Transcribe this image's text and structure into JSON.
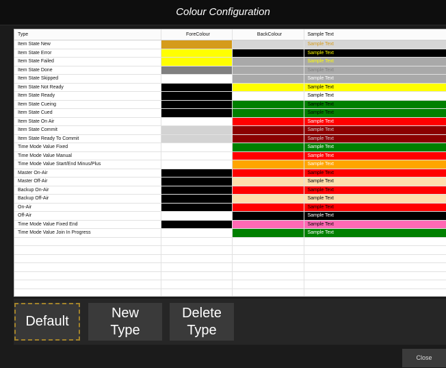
{
  "window": {
    "title": "Colour Configuration"
  },
  "table": {
    "headers": {
      "type": "Type",
      "fore": "ForeColour",
      "back": "BackColour",
      "sample": "Sample Text"
    },
    "rows": [
      {
        "type": "Item State New",
        "fore": "#d59b1b",
        "back": "#d6d6d6",
        "sample": "Sample Text",
        "sample_fg": "#d59b1b",
        "sample_bg": "#d6d6d6"
      },
      {
        "type": "Item State Error",
        "fore": "#ffff00",
        "back": "#000000",
        "sample": "Sample Text",
        "sample_fg": "#ffff00",
        "sample_bg": "#000000"
      },
      {
        "type": "Item State Failed",
        "fore": "#ffff00",
        "back": "#a9a9a9",
        "sample": "Sample Text",
        "sample_fg": "#ffff00",
        "sample_bg": "#a9a9a9"
      },
      {
        "type": "Item State Done",
        "fore": "#808080",
        "back": "#a9a9a9",
        "sample": "Sample Text",
        "sample_fg": "#808080",
        "sample_bg": "#a9a9a9"
      },
      {
        "type": "Item State Skipped",
        "fore": "#ffffff",
        "back": "#a9a9a9",
        "sample": "Sample Text",
        "sample_fg": "#ffffff",
        "sample_bg": "#a9a9a9"
      },
      {
        "type": "Item State Not Ready",
        "fore": "#000000",
        "back": "#ffff00",
        "sample": "Sample Text",
        "sample_fg": "#000000",
        "sample_bg": "#ffff00"
      },
      {
        "type": "Item State Ready",
        "fore": "#000000",
        "back": "#ffffff",
        "sample": "Sample Text",
        "sample_fg": "#000000",
        "sample_bg": "#ffffff"
      },
      {
        "type": "Item State Cueing",
        "fore": "#000000",
        "back": "#008000",
        "sample": "Sample Text",
        "sample_fg": "#000000",
        "sample_bg": "#008000"
      },
      {
        "type": "Item State Cued",
        "fore": "#000000",
        "back": "#008000",
        "sample": "Sample Text",
        "sample_fg": "#000000",
        "sample_bg": "#008000"
      },
      {
        "type": "Item State On Air",
        "fore": "#ffffff",
        "back": "#ff0000",
        "sample": "Sample Text",
        "sample_fg": "#ffffff",
        "sample_bg": "#ff0000"
      },
      {
        "type": "Item State Commit",
        "fore": "#d3d3d3",
        "back": "#8b0000",
        "sample": "Sample Text",
        "sample_fg": "#d3d3d3",
        "sample_bg": "#8b0000"
      },
      {
        "type": "Item State Ready To Commit",
        "fore": "#d3d3d3",
        "back": "#8b0000",
        "sample": "Sample Text",
        "sample_fg": "#d3d3d3",
        "sample_bg": "#8b0000"
      },
      {
        "type": "Time Mode Value Fixed",
        "fore": "#ffffff",
        "back": "#008000",
        "sample": "Sample Text",
        "sample_fg": "#ffffff",
        "sample_bg": "#008000"
      },
      {
        "type": "Time Mode Value Manual",
        "fore": "#ffffff",
        "back": "#ff0000",
        "sample": "Sample Text",
        "sample_fg": "#ffffff",
        "sample_bg": "#ff0000"
      },
      {
        "type": "Time Mode Value Start/End Minus/Plus",
        "fore": "#ffffff",
        "back": "#ffa500",
        "sample": "Sample Text",
        "sample_fg": "#ffffff",
        "sample_bg": "#ffa500"
      },
      {
        "type": "Master On-Air",
        "fore": "#000000",
        "back": "#ff0000",
        "sample": "Sample Text",
        "sample_fg": "#000000",
        "sample_bg": "#ff0000"
      },
      {
        "type": "Master Off-Air",
        "fore": "#000000",
        "back": "#ffdead",
        "sample": "Sample Text",
        "sample_fg": "#000000",
        "sample_bg": "#ffdead"
      },
      {
        "type": "Backup On-Air",
        "fore": "#000000",
        "back": "#ff0000",
        "sample": "Sample Text",
        "sample_fg": "#000000",
        "sample_bg": "#ff0000"
      },
      {
        "type": "Backup Off-Air",
        "fore": "#000000",
        "back": "#ffdead",
        "sample": "Sample Text",
        "sample_fg": "#000000",
        "sample_bg": "#ffdead"
      },
      {
        "type": "On-Air",
        "fore": "#000000",
        "back": "#ff0000",
        "sample": "Sample Text",
        "sample_fg": "#000000",
        "sample_bg": "#ff0000"
      },
      {
        "type": "Off-Air",
        "fore": "#ffffff",
        "back": "#000000",
        "sample": "Sample Text",
        "sample_fg": "#ffffff",
        "sample_bg": "#000000"
      },
      {
        "type": "Time Mode Value Fixed End",
        "fore": "#000000",
        "back": "#ff69b4",
        "sample": "Sample Text",
        "sample_fg": "#000000",
        "sample_bg": "#ff69b4"
      },
      {
        "type": "Time Mode Value Join In Progress",
        "fore": "#ffffff",
        "back": "#008000",
        "sample": "Sample Text",
        "sample_fg": "#ffffff",
        "sample_bg": "#008000"
      }
    ]
  },
  "buttons": {
    "default": "Default",
    "new_line1": "New",
    "new_line2": "Type",
    "delete_line1": "Delete",
    "delete_line2": "Type",
    "close": "Close"
  },
  "colors": {
    "window_bg": "#1b1b1b",
    "button_bg": "#3a3a3a",
    "default_border": "#a3832b"
  }
}
